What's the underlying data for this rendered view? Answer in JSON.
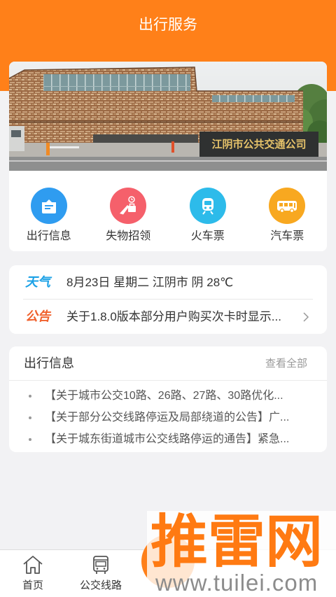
{
  "theme": {
    "primary": "#FF8019",
    "page_bg": "#F2F2F4",
    "weather_tag_color": "#1BA1E6",
    "announce_tag_color": "#F0612D"
  },
  "header": {
    "title": "出行服务"
  },
  "banner": {
    "sign_text": "江阴市公共交通公司"
  },
  "quick_links": [
    {
      "label": "出行信息",
      "icon": "travel-info-icon",
      "color": "#2F9CF0"
    },
    {
      "label": "失物招领",
      "icon": "lost-and-found-icon",
      "color": "#F5606B"
    },
    {
      "label": "火车票",
      "icon": "train-icon",
      "color": "#2DBBEA"
    },
    {
      "label": "汽车票",
      "icon": "coach-bus-icon",
      "color": "#F8A820"
    }
  ],
  "notice": {
    "weather_tag": "天气",
    "weather_text": "8月23日 星期二 江阴市 阴 28℃",
    "announce_tag": "公告",
    "announce_text": "关于1.8.0版本部分用户购买次卡时显示...",
    "more_icon": "chevron-right-icon"
  },
  "travel_info": {
    "title": "出行信息",
    "view_all": "查看全部",
    "items": [
      "【关于城市公交10路、26路、27路、30路优化...",
      "【关于部分公交线路停运及局部绕道的公告】广...",
      "【关于城东街道城市公交线路停运的通告】紧急..."
    ]
  },
  "bottom_nav": {
    "items": [
      {
        "label": "首页",
        "icon": "home-icon"
      },
      {
        "label": "公交线路",
        "icon": "bus-route-icon"
      }
    ]
  },
  "watermark": {
    "brand": "推雷网",
    "url": "www.tuilei.com"
  }
}
